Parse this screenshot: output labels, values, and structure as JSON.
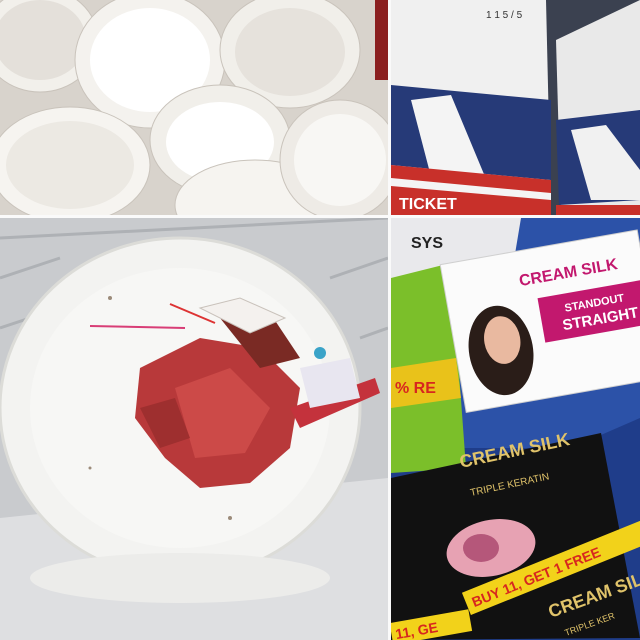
{
  "panels": [
    {
      "subject": "eggshells"
    },
    {
      "subject": "paper-bags",
      "visible_text": {
        "corner_label": "1 1 5 / 5",
        "banner": "TICKET"
      }
    },
    {
      "subject": "paper-plate-with-scraps"
    },
    {
      "subject": "shampoo-sachets",
      "visible_text": {
        "white_brand": "CREAM SILK",
        "white_variant_line1": "STANDOUT",
        "white_variant_line2": "STRAIGHT",
        "partial_sachet_text": "SYS",
        "green_sachet_text": "% RE",
        "black_brand": "CREAM SILK",
        "black_variant": "TRIPLE KERATIN",
        "promo": "BUY 11, GET 1 FREE",
        "promo_fragment": "11, GE",
        "black_brand_2": "CREAM SILK",
        "black_variant_2": "TRIPLE KER"
      }
    }
  ],
  "colors": {
    "shell": "#f1efea",
    "plate": "#f3f3f1",
    "meat": "#b8393a",
    "sachet_pink": "#c2186e",
    "sachet_black": "#111111",
    "promo_yellow": "#f2d21a",
    "promo_red": "#d7261f",
    "bag_navy": "#263a78",
    "bag_red": "#c8302a"
  }
}
